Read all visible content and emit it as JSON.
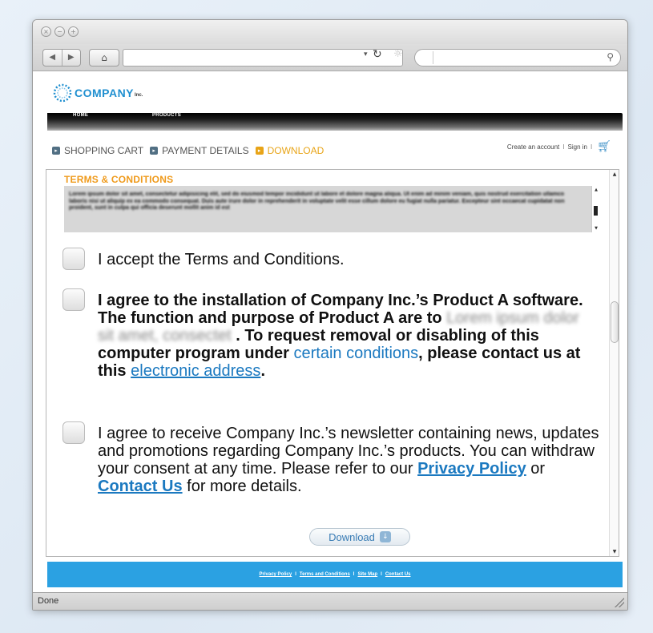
{
  "window": {
    "traffic": [
      "×",
      "−",
      "+"
    ],
    "nav_back": "◀",
    "nav_forward": "▶",
    "home_icon": "home-icon",
    "reload_glyph": "↻",
    "status": "Done"
  },
  "site": {
    "logo_text": "COMPANY",
    "logo_inc": "Inc.",
    "nav": {
      "home": "HOME",
      "products": "PRODUCTS"
    },
    "steps": [
      {
        "bullet": "▸",
        "label": "SHOPPING CART"
      },
      {
        "bullet": "▸",
        "label": "PAYMENT DETAILS"
      },
      {
        "bullet": "▸",
        "label": "DOWNLOAD"
      }
    ],
    "account": {
      "create": "Create an account",
      "sep": "I",
      "signin": "Sign in",
      "cart_icon": "cart-icon"
    }
  },
  "terms": {
    "title": "TERMS & CONDITIONS",
    "body": "Lorem ipsum dolor sit amet, consectetur adipisicing elit, sed do eiusmod tempor incididunt ut labore et dolore magna aliqua. Ut enim ad minim veniam, quis nostrud exercitation ullamco laboris nisi ut aliquip ex ea commodo consequat. Duis aute irure dolor in reprehenderit in voluptate velit esse cillum dolore eu fugiat nulla pariatur. Excepteur sint occaecat cupidatat non proident, sunt in culpa qui officia deserunt mollit anim id est"
  },
  "agreements": {
    "accept": "I accept the Terms and Conditions.",
    "install": {
      "text1": "I agree to the installation of Company Inc.’s Product A software. The function and purpose of Product A are to ",
      "blurred": "Lorem ipsum dolor sit amet, consectet",
      "text2": " . To request removal or disabling of this computer program under ",
      "link1": "certain conditions",
      "text3": ", please contact us at this ",
      "link2": "electronic address",
      "text4": "."
    },
    "newsletter": {
      "text1": "I agree to receive Company Inc.’s newsletter containing news, updates and promotions regarding Company Inc.’s products. You can withdraw your consent at any time. Please refer to our ",
      "link1": "Privacy Policy",
      "text2": " or ",
      "link2": "Contact Us",
      "text3": " for more details."
    }
  },
  "download_button": {
    "label": "Download",
    "icon": "↓"
  },
  "footer": {
    "links": [
      "Privacy Policy",
      "Terms and Conditions",
      "Site Map",
      "Contact Us"
    ],
    "sep": "I"
  },
  "colors": {
    "accent_orange": "#ef9a1b",
    "link_blue": "#1b79c0",
    "footer_blue": "#2ba1e2"
  }
}
